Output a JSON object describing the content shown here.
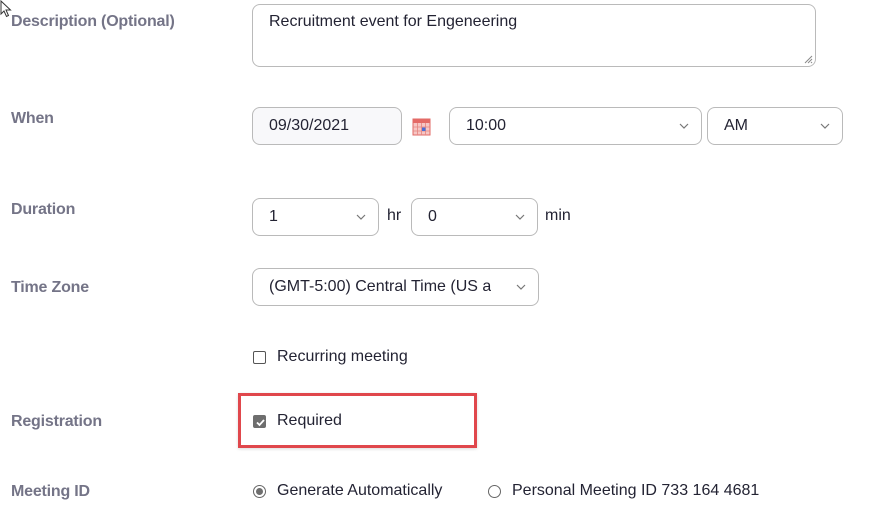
{
  "labels": {
    "description": "Description (Optional)",
    "when": "When",
    "duration": "Duration",
    "time_zone": "Time Zone",
    "registration": "Registration",
    "meeting_id": "Meeting ID"
  },
  "description": {
    "value": "Recruitment event for Engeneering"
  },
  "when": {
    "date": "09/30/2021",
    "calendar_icon": "calendar-icon",
    "time": "10:00",
    "ampm": "AM"
  },
  "duration": {
    "hours": "1",
    "hours_unit": "hr",
    "minutes": "0",
    "minutes_unit": "min"
  },
  "time_zone": {
    "selected": "(GMT-5:00) Central Time (US a"
  },
  "recurring": {
    "label": "Recurring meeting",
    "checked": false
  },
  "registration": {
    "label": "Required",
    "checked": true,
    "highlight_color": "#e0474c"
  },
  "meeting_id": {
    "options": [
      {
        "label": "Generate Automatically",
        "selected": true
      },
      {
        "label": "Personal Meeting ID 733 164 4681",
        "selected": false
      }
    ]
  }
}
